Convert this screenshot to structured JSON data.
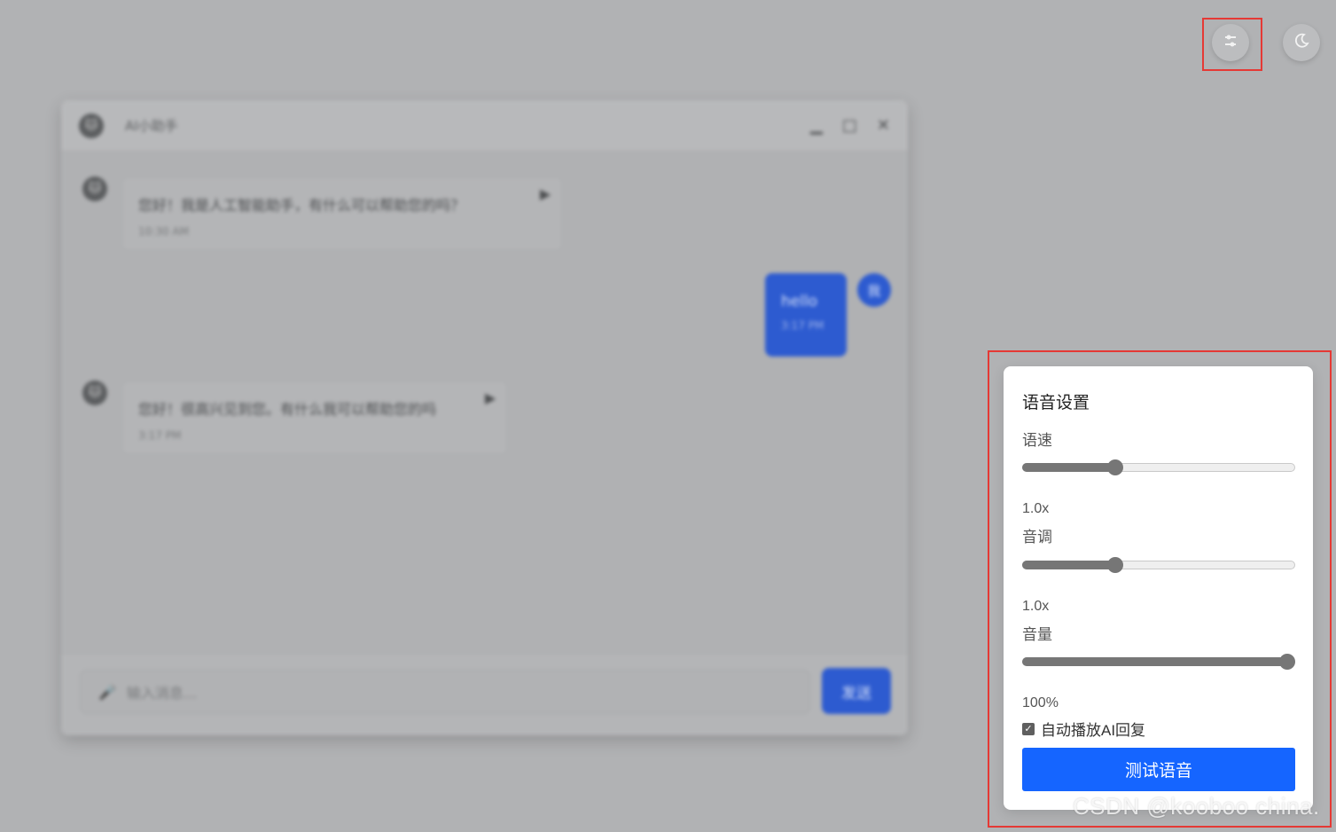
{
  "top_controls": {
    "settings_icon": "sliders-icon",
    "theme_icon": "moon-icon",
    "highlight_color": "#e53935"
  },
  "chat": {
    "title": "AI小助手",
    "window_controls": {
      "minimize": "▁",
      "maximize": "□",
      "close": "✕"
    },
    "messages": [
      {
        "role": "bot",
        "text": "您好！我是人工智能助手，有什么可以帮助您的吗？",
        "time": "10:30 AM"
      },
      {
        "role": "user",
        "text": "hello",
        "time": "3:17 PM",
        "avatar": "我"
      },
      {
        "role": "bot",
        "text": "您好！很高兴见到您。有什么我可以帮助您的吗",
        "time": "3:17 PM"
      }
    ],
    "input_placeholder": "输入消息...",
    "send_label": "发送",
    "accent_color": "#2d5bd0"
  },
  "voice_settings": {
    "title": "语音设置",
    "rate": {
      "label": "语速",
      "value_text": "1.0x",
      "fraction": 0.34
    },
    "pitch": {
      "label": "音调",
      "value_text": "1.0x",
      "fraction": 0.34
    },
    "volume": {
      "label": "音量",
      "value_text": "100%",
      "fraction": 0.97
    },
    "auto_play": {
      "label": "自动播放AI回复",
      "checked": true
    },
    "test_button_label": "测试语音",
    "button_color": "#1565ff"
  },
  "watermark": "CSDN @kooboo china."
}
